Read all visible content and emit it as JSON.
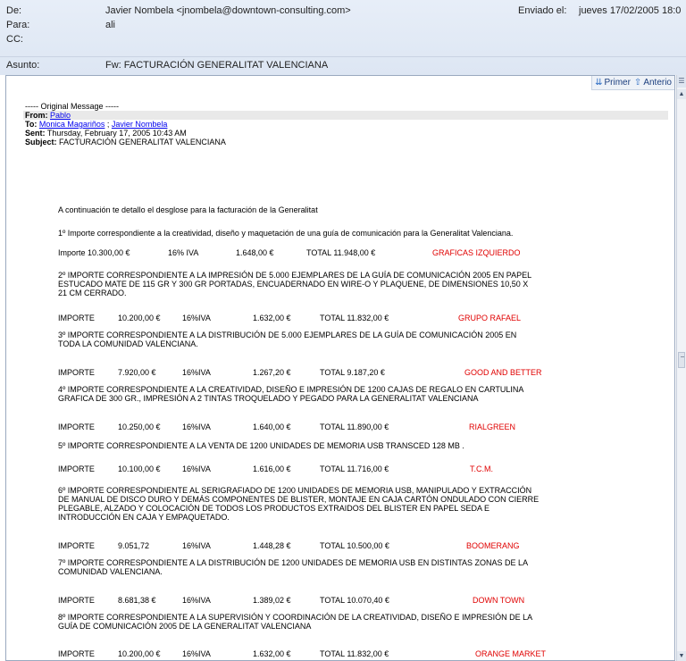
{
  "header": {
    "from_label": "De:",
    "from_value": "Javier Nombela <jnombela@downtown-consulting.com>",
    "to_label": "Para:",
    "to_value": "ali",
    "cc_label": "CC:",
    "cc_value": "",
    "subject_label": "Asunto:",
    "subject_value": "Fw: FACTURACIÓN GENERALITAT VALENCIANA",
    "sent_label": "Enviado el:",
    "sent_value": "jueves 17/02/2005 18:0"
  },
  "nav": {
    "first_label": "Primer",
    "prev_label": "Anterio"
  },
  "original": {
    "separator": "----- Original Message -----",
    "from_label": "From:",
    "from_value": "Pablo",
    "to_label": "To:",
    "to_value_1": "Monica Magariños",
    "to_sep": " ; ",
    "to_value_2": "Javier Nombela",
    "sent_label": "Sent:",
    "sent_value": "Thursday, February 17, 2005 10:43 AM",
    "subject_label": "Subject:",
    "subject_value": "FACTURACIÓN GENERALITAT VALENCIANA"
  },
  "body": {
    "intro": "A continuación te detallo el desglose para la facturación de la Generalitat",
    "items": [
      {
        "lines": [
          "1º Importe correspondiente a la creatividad, diseño y maquetación de una guía de comunicación para la Generalitat Valenciana."
        ],
        "importe_label": "Importe 10.300,00 €",
        "amount": "",
        "iva": "16% IVA",
        "iva_amount": "1.648,00 €",
        "total": "TOTAL  11.948,00 €",
        "vendor": "GRAFICAS IZQUIERDO"
      },
      {
        "lines": [
          "2º IMPORTE CORRESPONDIENTE A LA IMPRESIÓN DE 5.000 EJEMPLARES DE LA GUÍA DE COMUNICACIÓN 2005 EN PAPEL",
          "ESTUCADO MATE DE 115 GR Y 300 GR PORTADAS, ENCUADERNADO EN WIRE-O Y PLAQUENE, DE DIMENSIONES 10,50 X",
          "21 CM CERRADO."
        ],
        "importe_label": "IMPORTE",
        "amount": "10.200,00 €",
        "iva": "16%IVA",
        "iva_amount": "1.632,00 €",
        "total": "TOTAL  11.832,00 €",
        "vendor": "GRUPO RAFAEL"
      },
      {
        "lines": [
          "3º IMPORTE CORRESPONDIENTE A LA DISTRIBUCIÓN DE 5.000 EJEMPLARES DE LA GUÍA DE COMUNICACIÓN 2005 EN",
          "TODA LA COMUNIDAD VALENCIANA."
        ],
        "importe_label": "IMPORTE",
        "amount": "7.920,00 €",
        "iva": "16%IVA",
        "iva_amount": "1.267,20 €",
        "total": "TOTAL  9.187,20 €",
        "vendor": "GOOD AND BETTER"
      },
      {
        "lines": [
          "4º  IMPORTE CORRESPONDIENTE A LA CREATIVIDAD, DISEÑO E IMPRESIÓN DE 1200 CAJAS DE REGALO EN CARTULINA",
          "GRAFICA DE 300 GR., IMPRESIÓN A 2 TINTAS TROQUELADO Y PEGADO PARA LA GENERALITAT VALENCIANA"
        ],
        "importe_label": "IMPORTE",
        "amount": "10.250,00 €",
        "iva": "16%IVA",
        "iva_amount": "1.640,00 €",
        "total": "TOTAL  11.890,00 €",
        "vendor": "RIALGREEN"
      },
      {
        "lines": [
          "5º IMPORTE CORRESPONDIENTE A LA VENTA DE 1200 UNIDADES DE MEMORIA USB TRANSCED 128 MB ."
        ],
        "importe_label": "IMPORTE",
        "amount": "10.100,00 €",
        "iva": "16%IVA",
        "iva_amount": "1.616,00 €",
        "total": "TOTAL  11.716,00 €",
        "vendor": "T.C.M."
      },
      {
        "lines": [
          "6º IMPORTE CORRESPONDIENTE AL SERIGRAFIADO DE 1200 UNIDADES DE MEMORIA USB, MANIPULADO Y EXTRACCIÓN",
          "DE MANUAL DE DISCO DURO Y DEMÁS COMPONENTES DE BLISTER, MONTAJE EN CAJA CARTÓN ONDULADO CON  CIERRE",
          "PLEGABLE, ALZADO Y COLOCACIÓN DE TODOS LOS PRODUCTOS EXTRAIDOS DEL BLISTER EN PAPEL SEDA E",
          "INTRODUCCIÓN EN CAJA Y EMPAQUETADO."
        ],
        "importe_label": "IMPORTE",
        "amount": "9.051,72",
        "iva": "16%IVA",
        "iva_amount": "1.448,28 €",
        "total": "TOTAL  10.500,00 €",
        "vendor": "BOOMERANG"
      },
      {
        "lines": [
          "7º IMPORTE CORRESPONDIENTE A LA DISTRIBUCIÓN DE 1200 UNIDADES DE MEMORIA USB EN DISTINTAS ZONAS DE LA",
          "COMUNIDAD VALENCIANA."
        ],
        "importe_label": "IMPORTE",
        "amount": "8.681,38 €",
        "iva": "16%IVA",
        "iva_amount": "1.389,02 €",
        "total": "TOTAL  10.070,40 €",
        "vendor": "DOWN TOWN"
      },
      {
        "lines": [
          "8º IMPORTE CORRESPONDIENTE A LA SUPERVISIÓN Y COORDINACIÓN DE LA CREATIVIDAD, DISEÑO E IMPRESIÓN DE LA",
          "GUÍA DE COMUNICACIÓN 2005 DE LA GENERALITAT VALENCIANA"
        ],
        "importe_label": "IMPORTE",
        "amount": "10.200,00 €",
        "iva": "16%IVA",
        "iva_amount": "1.632,00 €",
        "total": "TOTAL  11.832,00 €",
        "vendor": "ORANGE MARKET"
      }
    ]
  },
  "icons": {
    "first": "double-arrow-down-icon",
    "prev": "arrow-up-icon",
    "scroll_up": "scroll-up-arrow-icon",
    "scroll_down": "scroll-down-arrow-icon"
  },
  "colors": {
    "vendor": "#e00000",
    "link": "#0000ee",
    "header_bg": "#e7eef8"
  }
}
